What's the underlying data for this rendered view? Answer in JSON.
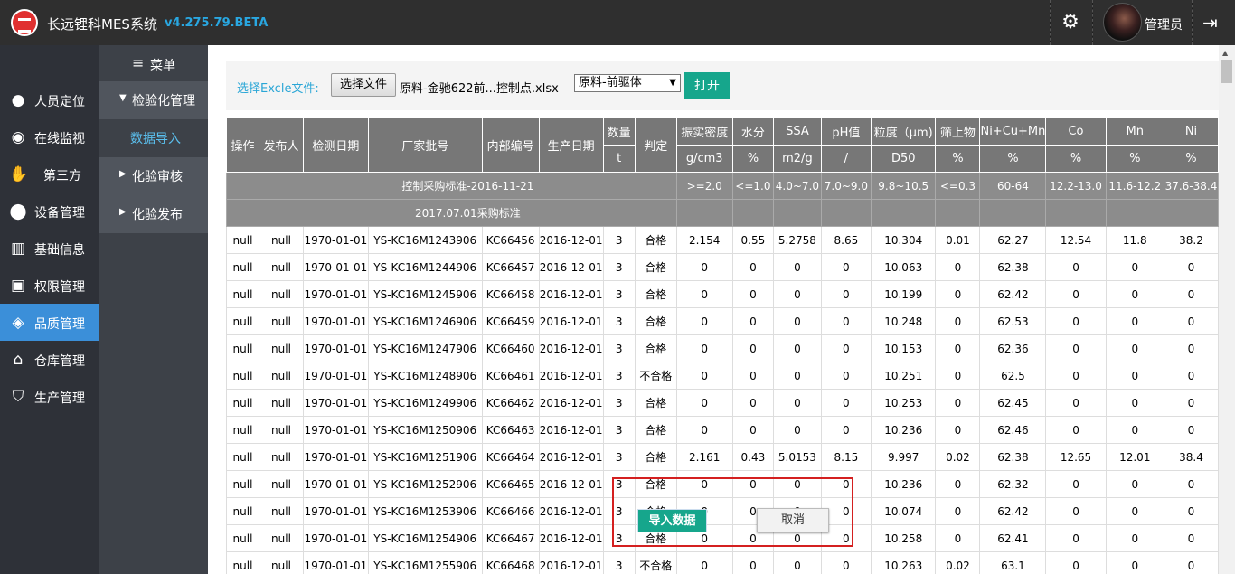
{
  "header": {
    "title": "长远锂科MES系统",
    "version": "v4.275.79.BETA",
    "username": "管理员"
  },
  "sidebar": {
    "items": [
      {
        "label": "人员定位",
        "icon": "user-pin-icon"
      },
      {
        "label": "在线监视",
        "icon": "monitor-icon"
      },
      {
        "label": "第三方",
        "icon": "handshake-icon"
      },
      {
        "label": "设备管理",
        "icon": "device-icon"
      },
      {
        "label": "基础信息",
        "icon": "info-icon"
      },
      {
        "label": "权限管理",
        "icon": "lock-icon"
      },
      {
        "label": "品质管理",
        "icon": "shield-icon"
      },
      {
        "label": "仓库管理",
        "icon": "home-icon"
      },
      {
        "label": "生产管理",
        "icon": "production-icon"
      }
    ],
    "active": "品质管理"
  },
  "submenu": {
    "header": "菜单",
    "groups": [
      {
        "label": "检验化管理"
      },
      {
        "label": "数据导入"
      },
      {
        "label": "化验审核"
      },
      {
        "label": "化验发布"
      }
    ]
  },
  "toolbar": {
    "label": "选择Excle文件:",
    "file_button": "选择文件",
    "file_name": "原料-金驰622前...控制点.xlsx",
    "select_value": "原料-前驱体",
    "open_button": "打开"
  },
  "table": {
    "head1": [
      "操作",
      "发布人",
      "检测日期",
      "厂家批号",
      "内部编号",
      "生产日期",
      "数量",
      "判定",
      "振实密度",
      "水分",
      "SSA",
      "pH值",
      "粒度（μm)",
      "筛上物",
      "Ni+Cu+Mn",
      "Co",
      "Mn",
      "Ni"
    ],
    "head2": [
      "t",
      "g/cm3",
      "%",
      "m2/g",
      "/",
      "D50",
      "%",
      "%",
      "%",
      "%",
      "%"
    ],
    "std1": {
      "label": "控制采购标准-2016-11-21",
      "values": [
        ">=2.0",
        "<=1.0",
        "4.0~7.0",
        "7.0~9.0",
        "9.8~10.5",
        "<=0.3",
        "60-64",
        "12.2-13.0",
        "11.6-12.2",
        "37.6-38.4"
      ]
    },
    "std2": {
      "label": "2017.07.01采购标准"
    },
    "rows": [
      [
        "null",
        "null",
        "1970-01-01",
        "YS-KC16M1243906",
        "KC66456",
        "2016-12-01",
        "3",
        "合格",
        "2.154",
        "0.55",
        "5.2758",
        "8.65",
        "10.304",
        "0.01",
        "62.27",
        "12.54",
        "11.8",
        "38.2"
      ],
      [
        "null",
        "null",
        "1970-01-01",
        "YS-KC16M1244906",
        "KC66457",
        "2016-12-01",
        "3",
        "合格",
        "0",
        "0",
        "0",
        "0",
        "10.063",
        "0",
        "62.38",
        "0",
        "0",
        "0"
      ],
      [
        "null",
        "null",
        "1970-01-01",
        "YS-KC16M1245906",
        "KC66458",
        "2016-12-01",
        "3",
        "合格",
        "0",
        "0",
        "0",
        "0",
        "10.199",
        "0",
        "62.42",
        "0",
        "0",
        "0"
      ],
      [
        "null",
        "null",
        "1970-01-01",
        "YS-KC16M1246906",
        "KC66459",
        "2016-12-01",
        "3",
        "合格",
        "0",
        "0",
        "0",
        "0",
        "10.248",
        "0",
        "62.53",
        "0",
        "0",
        "0"
      ],
      [
        "null",
        "null",
        "1970-01-01",
        "YS-KC16M1247906",
        "KC66460",
        "2016-12-01",
        "3",
        "合格",
        "0",
        "0",
        "0",
        "0",
        "10.153",
        "0",
        "62.36",
        "0",
        "0",
        "0"
      ],
      [
        "null",
        "null",
        "1970-01-01",
        "YS-KC16M1248906",
        "KC66461",
        "2016-12-01",
        "3",
        "不合格",
        "0",
        "0",
        "0",
        "0",
        "10.251",
        "0",
        "62.5",
        "0",
        "0",
        "0"
      ],
      [
        "null",
        "null",
        "1970-01-01",
        "YS-KC16M1249906",
        "KC66462",
        "2016-12-01",
        "3",
        "合格",
        "0",
        "0",
        "0",
        "0",
        "10.253",
        "0",
        "62.45",
        "0",
        "0",
        "0"
      ],
      [
        "null",
        "null",
        "1970-01-01",
        "YS-KC16M1250906",
        "KC66463",
        "2016-12-01",
        "3",
        "合格",
        "0",
        "0",
        "0",
        "0",
        "10.236",
        "0",
        "62.46",
        "0",
        "0",
        "0"
      ],
      [
        "null",
        "null",
        "1970-01-01",
        "YS-KC16M1251906",
        "KC66464",
        "2016-12-01",
        "3",
        "合格",
        "2.161",
        "0.43",
        "5.0153",
        "8.15",
        "9.997",
        "0.02",
        "62.38",
        "12.65",
        "12.01",
        "38.4"
      ],
      [
        "null",
        "null",
        "1970-01-01",
        "YS-KC16M1252906",
        "KC66465",
        "2016-12-01",
        "3",
        "合格",
        "0",
        "0",
        "0",
        "0",
        "10.236",
        "0",
        "62.32",
        "0",
        "0",
        "0"
      ],
      [
        "null",
        "null",
        "1970-01-01",
        "YS-KC16M1253906",
        "KC66466",
        "2016-12-01",
        "3",
        "合格",
        "0",
        "0",
        "0",
        "0",
        "10.074",
        "0",
        "62.42",
        "0",
        "0",
        "0"
      ],
      [
        "null",
        "null",
        "1970-01-01",
        "YS-KC16M1254906",
        "KC66467",
        "2016-12-01",
        "3",
        "合格",
        "0",
        "0",
        "0",
        "0",
        "10.258",
        "0",
        "62.41",
        "0",
        "0",
        "0"
      ],
      [
        "null",
        "null",
        "1970-01-01",
        "YS-KC16M1255906",
        "KC66468",
        "2016-12-01",
        "3",
        "不合格",
        "0",
        "0",
        "0",
        "0",
        "10.263",
        "0.02",
        "63.1",
        "0",
        "0",
        "0"
      ]
    ]
  },
  "dialog": {
    "import_button": "导入数据",
    "cancel_button": "取消"
  },
  "colors": {
    "topbar": "#2f2f2f",
    "sidebar": "#2e3138",
    "active": "#3b8fd9",
    "accent": "#16a68c",
    "highlight_border": "#d42020"
  }
}
